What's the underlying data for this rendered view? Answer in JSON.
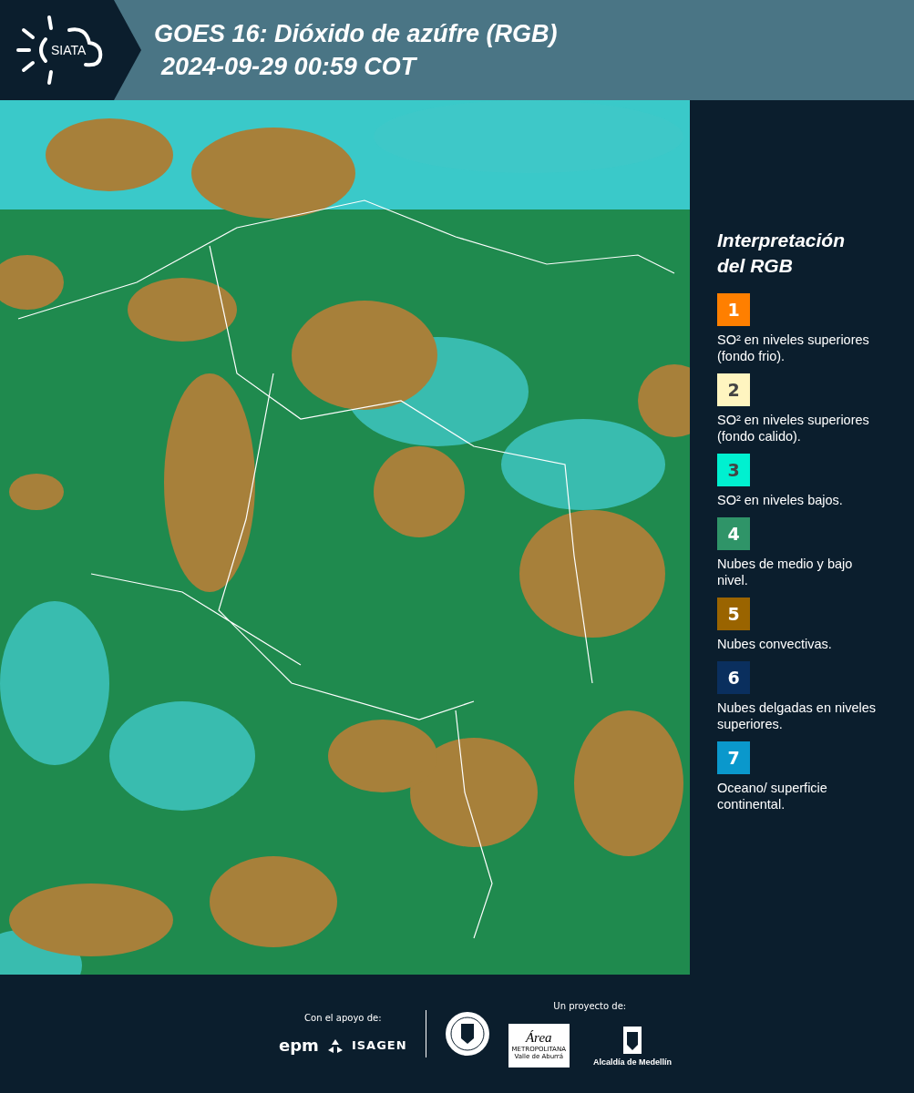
{
  "header": {
    "logo_text": "SIATA",
    "title_lines": [
      "GOES 16: Dióxido de azúfre (RGB)",
      "2024-09-29 00:59 COT"
    ]
  },
  "legend": {
    "title_lines": [
      "Interpretación",
      "del RGB"
    ],
    "items": [
      {
        "number": "1",
        "color": "#ff7f00",
        "dark_text": false,
        "label": "SO² en niveles superiores (fondo frio)."
      },
      {
        "number": "2",
        "color": "#fff5c0",
        "dark_text": true,
        "label": "SO² en niveles superiores (fondo calido)."
      },
      {
        "number": "3",
        "color": "#00f0d0",
        "dark_text": true,
        "label": "SO² en niveles bajos."
      },
      {
        "number": "4",
        "color": "#2f9468",
        "dark_text": false,
        "label": "Nubes de medio y bajo nivel."
      },
      {
        "number": "5",
        "color": "#9a6400",
        "dark_text": false,
        "label": "Nubes convectivas."
      },
      {
        "number": "6",
        "color": "#0a2f5e",
        "dark_text": false,
        "label": "Nubes delgadas en niveles superiores."
      },
      {
        "number": "7",
        "color": "#0a98cc",
        "dark_text": false,
        "label": "Oceano/ superficie continental."
      }
    ]
  },
  "footer": {
    "support_label": "Con el apoyo de:",
    "project_label": "Un proyecto de:",
    "epm": "epm",
    "isagen": "ISAGEN",
    "area": "Área",
    "area_sub": [
      "METROPOLITANA",
      "Valle de Aburrá"
    ],
    "alcaldia": "Alcaldía de Medellín"
  }
}
